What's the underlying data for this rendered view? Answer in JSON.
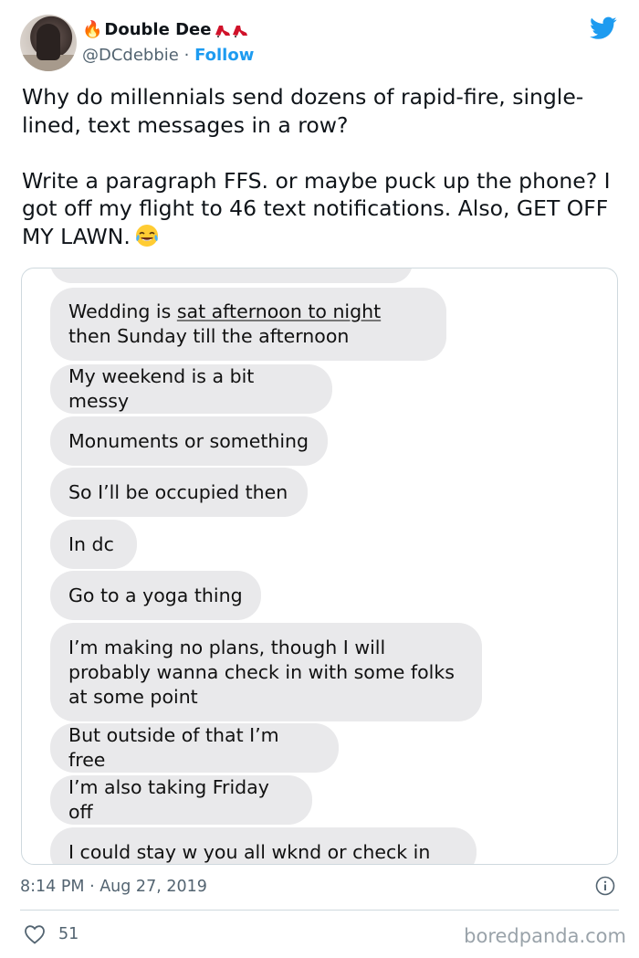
{
  "author": {
    "flame_icon": "🔥",
    "display_name": "Double Dee",
    "handle": "@DCdebbie",
    "separator": "·",
    "follow_label": "Follow"
  },
  "tweet": {
    "text_part1": "Why do millennials send dozens of rapid-fire, single-lined, text messages in a row?\n\nWrite a paragraph FFS. or maybe puck up the phone? I got off my flight to 46 text notifications. Also, GET OFF MY LAWN.",
    "emoji_icon": "face-with-tears-of-joy-icon",
    "timestamp": "8:14 PM · Aug 27, 2019",
    "like_count": "51"
  },
  "messages": {
    "m1_a": "Wedding is ",
    "m1_underlined": "sat afternoon to night",
    "m1_b": " then Sunday till the afternoon",
    "m2": "My weekend is a bit messy",
    "m3": "Monuments or something",
    "m4": "So I’ll be occupied then",
    "m5": "In dc",
    "m6": "Go to a yoga thing",
    "m7": "I’m making no plans, though I will probably wanna check in with some folks at some point",
    "m8": "But outside of that I’m free",
    "m9": "I’m also taking Friday off",
    "m10": "I could stay w you all wknd or check in"
  },
  "watermark": "boredpanda.com",
  "colors": {
    "twitter_blue": "#1d9bf0",
    "bubble_gray": "#e9e9eb",
    "secondary_text": "#536471",
    "heel_red": "#d0122a"
  }
}
